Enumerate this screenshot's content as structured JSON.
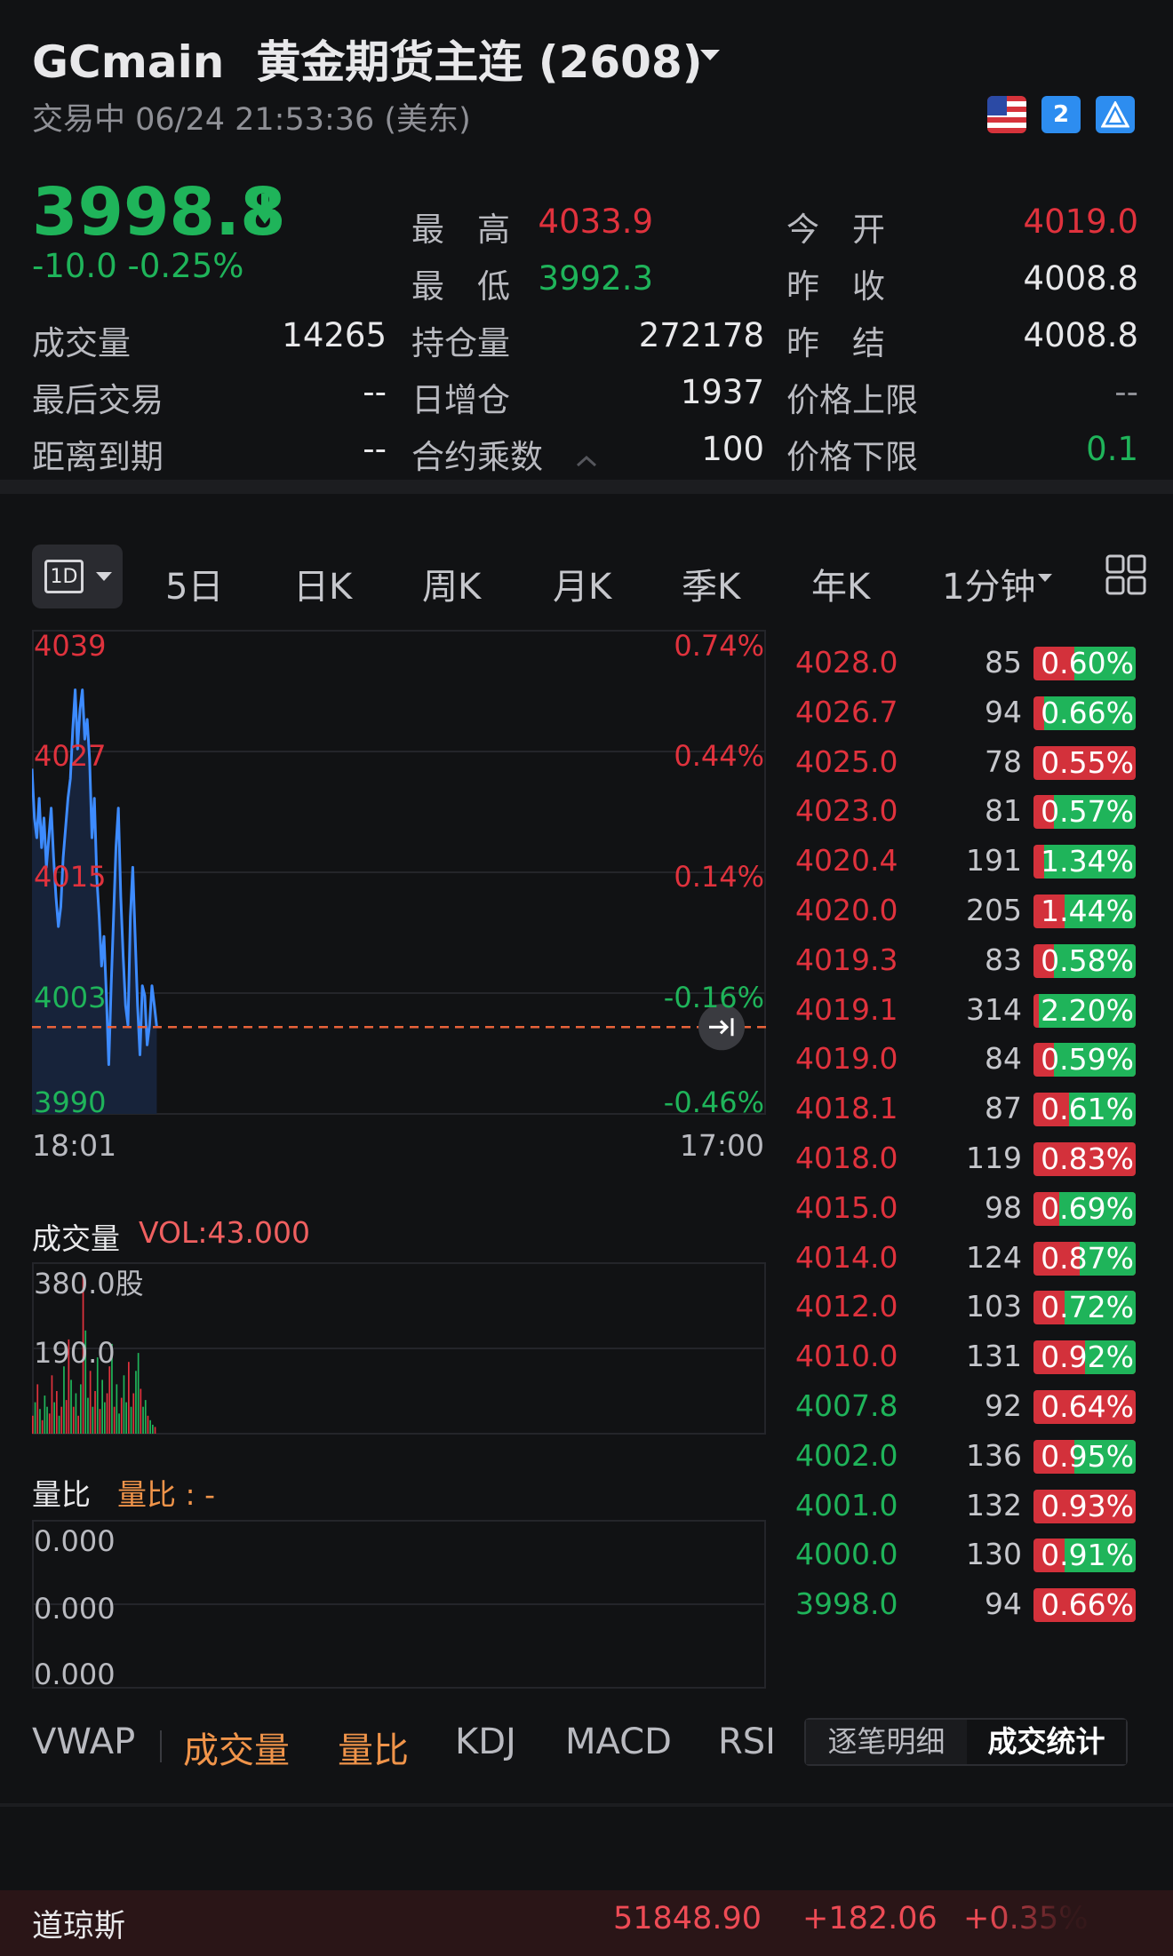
{
  "header": {
    "symbol": "GCmain",
    "name": "黄金期货主连 (2608)",
    "status": "交易中 06/24 21:53:36 (美东)",
    "icons": [
      "us-flag-icon",
      "level2-icon",
      "pyramid-icon"
    ],
    "lv2_text": "2"
  },
  "quote": {
    "price": "3998.8",
    "change": "-10.0 -0.25%",
    "fields": [
      {
        "label": "最　高",
        "value": "4033.9",
        "tone": "up"
      },
      {
        "label": "今　开",
        "value": "4019.0",
        "tone": "up"
      },
      {
        "label": "最　低",
        "value": "3992.3",
        "tone": "down"
      },
      {
        "label": "昨　收",
        "value": "4008.8",
        "tone": "white"
      },
      {
        "label": "成交量",
        "value": "14265",
        "tone": "white"
      },
      {
        "label": "持仓量",
        "value": "272178",
        "tone": "white"
      },
      {
        "label": "昨　结",
        "value": "4008.8",
        "tone": "white"
      },
      {
        "label": "最后交易",
        "value": "--",
        "tone": "white"
      },
      {
        "label": "日增仓",
        "value": "1937",
        "tone": "white"
      },
      {
        "label": "价格上限",
        "value": "--",
        "tone": "grey"
      },
      {
        "label": "距离到期",
        "value": "--",
        "tone": "white"
      },
      {
        "label": "合约乘数",
        "value": "100",
        "tone": "white"
      },
      {
        "label": "价格下限",
        "value": "0.1",
        "tone": "down"
      }
    ]
  },
  "tabs": {
    "intraday_box": "1D",
    "items": [
      "5日",
      "日K",
      "周K",
      "月K",
      "季K",
      "年K"
    ],
    "interval": "1分钟"
  },
  "colors": {
    "up": "#e0323d",
    "down": "#1fb45a",
    "line": "#3d8bff",
    "accent_orange": "#f0944a",
    "vol_label": "#f06060"
  },
  "chart_data": {
    "type": "line",
    "title": "",
    "y_labels": [
      "4039",
      "4027",
      "4015",
      "4003",
      "3990"
    ],
    "pct_labels": [
      "0.74%",
      "0.44%",
      "0.14%",
      "-0.16%",
      "-0.46%"
    ],
    "x_labels": [
      "18:01",
      "17:00"
    ],
    "ylim": [
      3990,
      4039
    ],
    "reference_close": 4008.8,
    "x_session_fraction": [
      0,
      0.17
    ],
    "price_series": [
      4025,
      4020,
      4018,
      4022,
      4017,
      4020,
      4015,
      4018,
      4021,
      4016,
      4012,
      4009,
      4011,
      4016,
      4019,
      4022,
      4024,
      4029,
      4033,
      4027,
      4031,
      4033,
      4028,
      4030,
      4026,
      4018,
      4022,
      4014,
      4010,
      4005,
      4008,
      4002,
      3995,
      4003,
      4010,
      4017,
      4021,
      4012,
      4006,
      4001,
      3999,
      4010,
      4015,
      4008,
      4001,
      3996,
      4003,
      4002,
      3997,
      3999,
      4003,
      4001,
      3998.8
    ],
    "volume": {
      "title": "成交量",
      "label": "VOL:43.000",
      "y_labels": [
        "380.0股",
        "190.0"
      ],
      "ylim": [
        0,
        380
      ],
      "bars": [
        40,
        70,
        110,
        55,
        30,
        85,
        60,
        45,
        130,
        70,
        95,
        40,
        60,
        150,
        75,
        210,
        120,
        60,
        90,
        40,
        110,
        350,
        230,
        80,
        140,
        60,
        95,
        170,
        55,
        120,
        70,
        90,
        150,
        200,
        60,
        110,
        45,
        80,
        130,
        70,
        160,
        60,
        90,
        140,
        180,
        100,
        60,
        75,
        40,
        30,
        20,
        15
      ],
      "bar_tones": [
        "up",
        "down",
        "up",
        "down",
        "up",
        "down",
        "down",
        "up",
        "up",
        "down",
        "up",
        "down",
        "up",
        "down",
        "up",
        "up",
        "down",
        "up",
        "down",
        "up",
        "down",
        "up",
        "down",
        "down",
        "up",
        "down",
        "up",
        "down",
        "up",
        "down",
        "down",
        "up",
        "up",
        "down",
        "up",
        "down",
        "down",
        "up",
        "down",
        "down",
        "up",
        "down",
        "up",
        "down",
        "down",
        "up",
        "down",
        "down",
        "up",
        "down",
        "down",
        "up"
      ]
    },
    "ratio": {
      "title": "量比",
      "label": "量比 : -",
      "y_labels": [
        "0.000",
        "0.000",
        "0.000"
      ]
    }
  },
  "trade_stats": [
    {
      "price": "4028.0",
      "vol": "85",
      "pct": "0.60%",
      "buy": 0.6,
      "tone": "up"
    },
    {
      "price": "4026.7",
      "vol": "94",
      "pct": "0.66%",
      "buy": 0.9,
      "tone": "up"
    },
    {
      "price": "4025.0",
      "vol": "78",
      "pct": "0.55%",
      "buy": 0.0,
      "tone": "up"
    },
    {
      "price": "4023.0",
      "vol": "81",
      "pct": "0.57%",
      "buy": 0.8,
      "tone": "up"
    },
    {
      "price": "4020.4",
      "vol": "191",
      "pct": "1.34%",
      "buy": 0.9,
      "tone": "up"
    },
    {
      "price": "4020.0",
      "vol": "205",
      "pct": "1.44%",
      "buy": 0.7,
      "tone": "up"
    },
    {
      "price": "4019.3",
      "vol": "83",
      "pct": "0.58%",
      "buy": 0.8,
      "tone": "up"
    },
    {
      "price": "4019.1",
      "vol": "314",
      "pct": "2.20%",
      "buy": 0.95,
      "tone": "up"
    },
    {
      "price": "4019.0",
      "vol": "84",
      "pct": "0.59%",
      "buy": 0.8,
      "tone": "up"
    },
    {
      "price": "4018.1",
      "vol": "87",
      "pct": "0.61%",
      "buy": 0.65,
      "tone": "up"
    },
    {
      "price": "4018.0",
      "vol": "119",
      "pct": "0.83%",
      "buy": 0.0,
      "tone": "up"
    },
    {
      "price": "4015.0",
      "vol": "98",
      "pct": "0.69%",
      "buy": 0.75,
      "tone": "up"
    },
    {
      "price": "4014.0",
      "vol": "124",
      "pct": "0.87%",
      "buy": 0.55,
      "tone": "up"
    },
    {
      "price": "4012.0",
      "vol": "103",
      "pct": "0.72%",
      "buy": 0.7,
      "tone": "up"
    },
    {
      "price": "4010.0",
      "vol": "131",
      "pct": "0.92%",
      "buy": 0.5,
      "tone": "up"
    },
    {
      "price": "4007.8",
      "vol": "92",
      "pct": "0.64%",
      "buy": 0.0,
      "tone": "down"
    },
    {
      "price": "4002.0",
      "vol": "136",
      "pct": "0.95%",
      "buy": 0.6,
      "tone": "down"
    },
    {
      "price": "4001.0",
      "vol": "132",
      "pct": "0.93%",
      "buy": 0.0,
      "tone": "down"
    },
    {
      "price": "4000.0",
      "vol": "130",
      "pct": "0.91%",
      "buy": 0.7,
      "tone": "down"
    },
    {
      "price": "3998.0",
      "vol": "94",
      "pct": "0.66%",
      "buy": 0.0,
      "tone": "down"
    }
  ],
  "indicators": {
    "items": [
      {
        "label": "VWAP",
        "tone": "plain"
      },
      {
        "label": "成交量",
        "tone": "active"
      },
      {
        "label": "量比",
        "tone": "active"
      },
      {
        "label": "KDJ",
        "tone": "plain"
      },
      {
        "label": "MACD",
        "tone": "plain"
      },
      {
        "label": "RSI",
        "tone": "plain"
      }
    ],
    "segments": [
      "逐笔明细",
      "成交统计"
    ]
  },
  "ticker": {
    "name": "道琼斯",
    "value": "51848.90",
    "change": "+182.06",
    "pct": "+0.35%"
  }
}
